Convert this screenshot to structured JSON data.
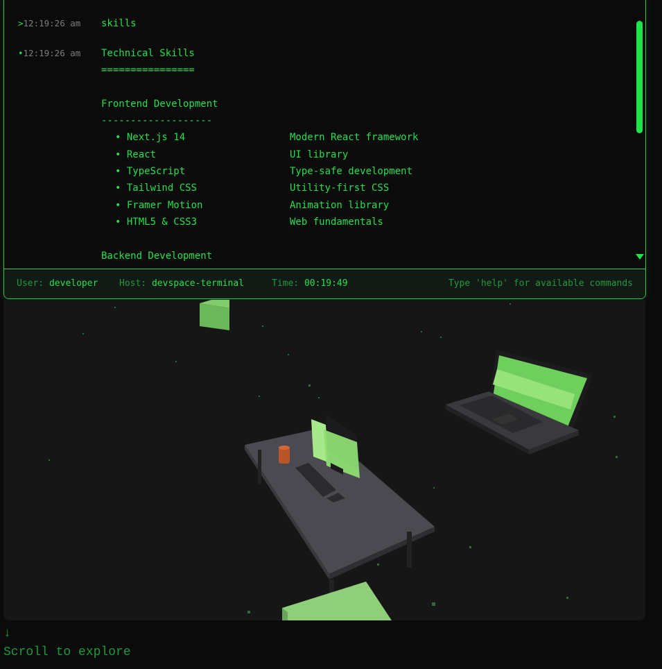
{
  "terminal": {
    "entries": [
      {
        "marker": ">",
        "time": "12:19:26 am",
        "text": "skills"
      },
      {
        "marker": "•",
        "time": "12:19:26 am",
        "text": "Technical Skills"
      }
    ],
    "underline_title": "================",
    "section_frontend": "Frontend Development",
    "underline_frontend": "-------------------",
    "frontend_skills": [
      {
        "name": "• Next.js 14",
        "desc": "Modern React framework"
      },
      {
        "name": "• React",
        "desc": "UI library"
      },
      {
        "name": "• TypeScript",
        "desc": "Type-safe development"
      },
      {
        "name": "• Tailwind CSS",
        "desc": "Utility-first CSS"
      },
      {
        "name": "• Framer Motion",
        "desc": "Animation library"
      },
      {
        "name": "• HTML5 & CSS3",
        "desc": "Web fundamentals"
      }
    ],
    "section_backend": "Backend Development"
  },
  "statusbar": {
    "user_label": "User:",
    "user_value": "developer",
    "host_label": "Host:",
    "host_value": "devspace-terminal",
    "time_label": "Time:",
    "time_value": "00:19:49",
    "help_hint": "Type 'help' for available commands"
  },
  "scroll_hint": {
    "arrow": "↓",
    "label": "Scroll to explore"
  },
  "colors": {
    "accent": "#22e04a",
    "muted_green": "#1c9a3a",
    "background": "#0b0b0b",
    "scene_bg": "#161616",
    "monitor_green": "#7dd86a"
  }
}
